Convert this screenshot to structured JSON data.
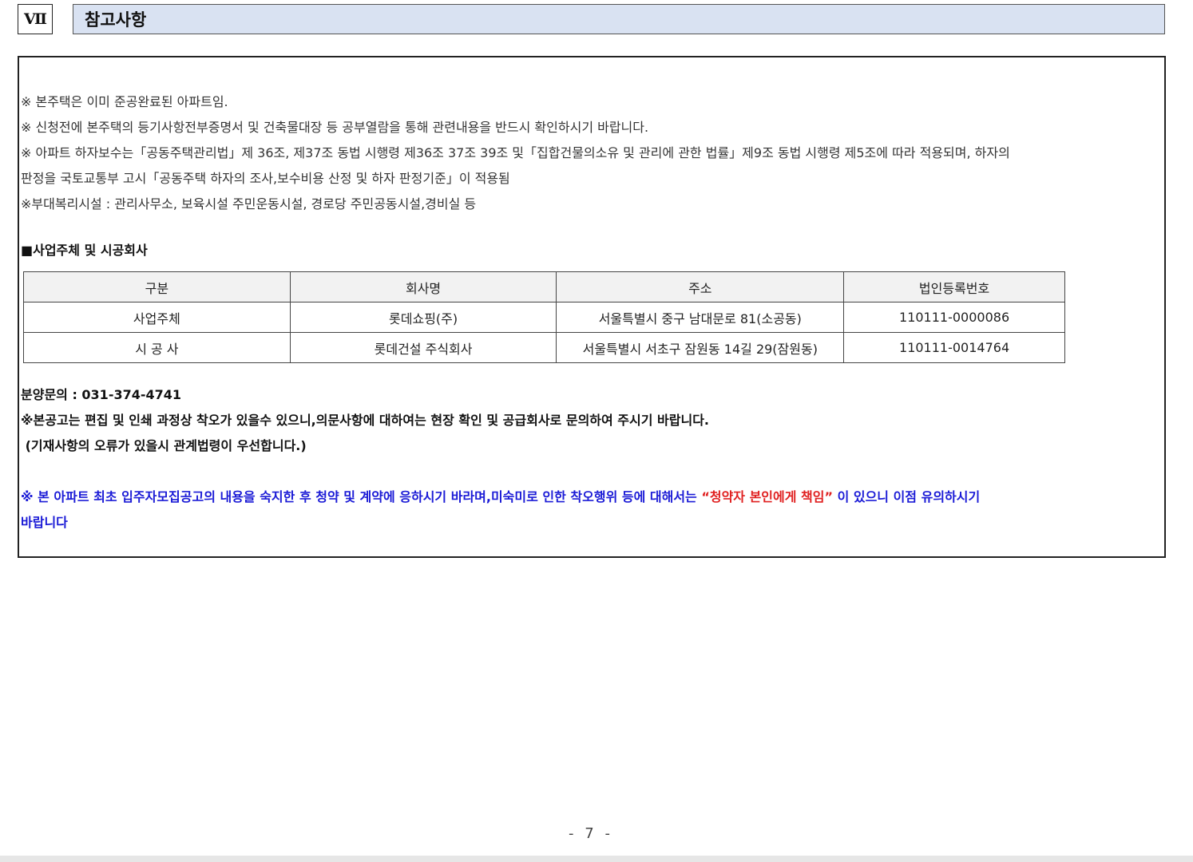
{
  "section": {
    "number": "Ⅶ",
    "title": "참고사항"
  },
  "notes": [
    "※ 본주택은 이미 준공완료된 아파트임.",
    "※ 신청전에 본주택의 등기사항전부증명서 및 건축물대장 등 공부열람을 통해 관련내용을 반드시 확인하시기 바랍니다.",
    "※ 아파트 하자보수는「공동주택관리법」제 36조, 제37조 동법 시행령 제36조 37조 39조 및「집합건물의소유 및 관리에 관한 법률」제9조  동법 시행령 제5조에 따라 적용되며, 하자의",
    "판정을 국토교통부 고시「공동주택 하자의 조사,보수비용 산정 및 하자 판정기준」이 적용됨",
    "※부대복리시설 : 관리사무소, 보육시설 주민운동시설, 경로당 주민공동시설,경비실 등"
  ],
  "company_section": {
    "heading": "■사업주체 및 시공회사",
    "columns": [
      "구분",
      "회사명",
      "주소",
      "법인등록번호"
    ],
    "rows": [
      [
        "사업주체",
        "롯데쇼핑(주)",
        "서울특별시 중구 남대문로 81(소공동)",
        "110111-0000086"
      ],
      [
        "시 공 사",
        "롯데건설 주식회사",
        "서울특별시 서초구 잠원동 14길 29(잠원동)",
        "110111-0014764"
      ]
    ]
  },
  "inquiry": "분양문의 : 031-374-4741",
  "disclaimer_1": "※본공고는 편집 및 인쇄 과정상 착오가 있을수 있으니,의문사항에 대하여는 현장 확인 및 공급회사로 문의하여 주시기 바랍니다.",
  "disclaimer_2": " (기재사항의 오류가 있을시 관계법령이 우선합니다.)",
  "warning": {
    "part1": "※ 본 아파트 최초 입주자모집공고의 내용을 숙지한 후 청약 및 계약에 응하시기 바라며,미숙미로 인한 착오행위 등에 대해서는 ",
    "highlight": "“청약자 본인에게 책임”",
    "part2": " 이 있으니 이점 유의하시기",
    "line2": "바랍니다"
  },
  "page_number": "- 7 -",
  "colors": {
    "header_bg": "#d9e2f2",
    "warning_blue": "#1a1ad6",
    "warning_red": "#e02020"
  }
}
